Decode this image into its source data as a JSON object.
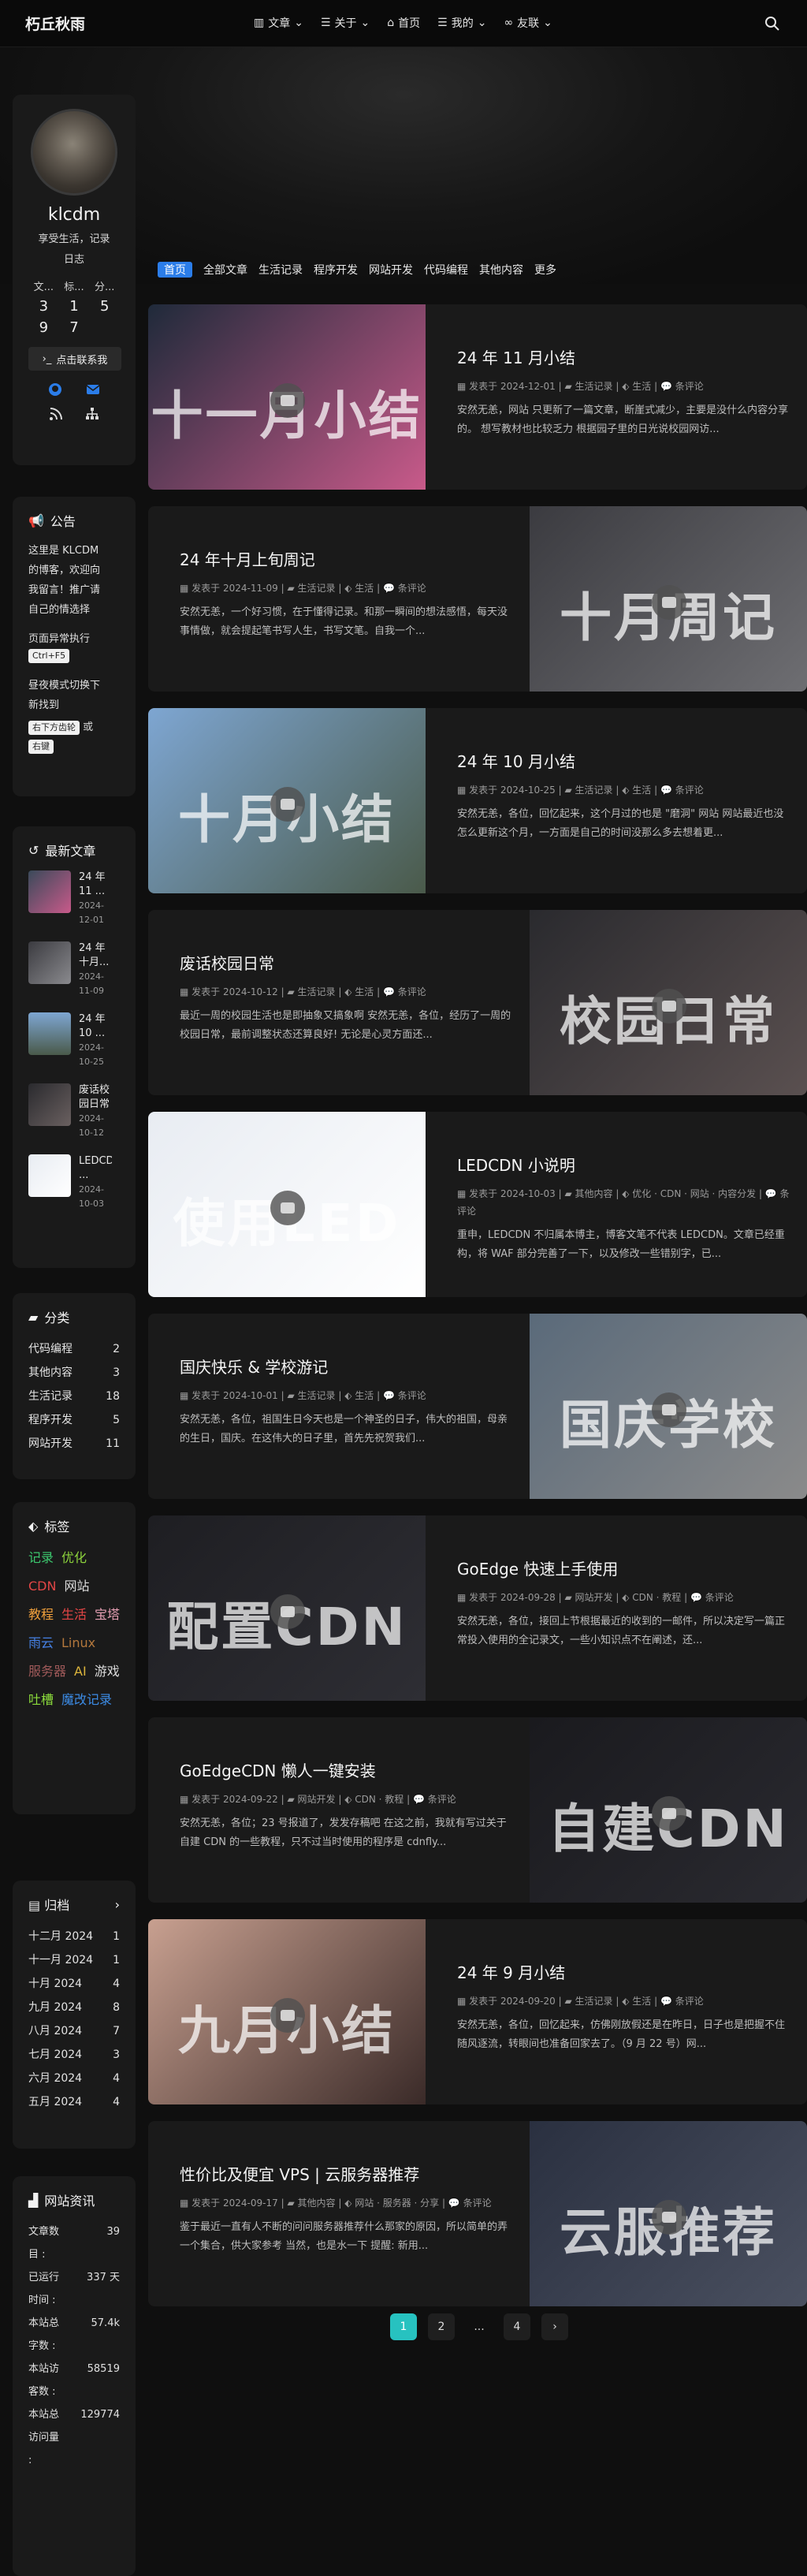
{
  "nav": {
    "logo": "朽丘秋雨",
    "items": [
      {
        "label": "文章",
        "icon": "books-icon"
      },
      {
        "label": "关于",
        "icon": "list-icon"
      },
      {
        "label": "首页",
        "icon": "home-icon"
      },
      {
        "label": "我的",
        "icon": "list-icon"
      },
      {
        "label": "友联",
        "icon": "link-icon"
      }
    ]
  },
  "author": {
    "name": "klcdm",
    "desc_lines": [
      "享受生活，记录",
      "日志"
    ],
    "stats": [
      {
        "label": "文...",
        "value": "3"
      },
      {
        "label": "标...",
        "value": "1"
      },
      {
        "label": "分...",
        "value": "5"
      },
      {
        "label": "",
        "value": "9"
      },
      {
        "label": "",
        "value": "7"
      },
      {
        "label": "",
        "value": ""
      }
    ],
    "contact_label": "点击联系我"
  },
  "announcement": {
    "title": "公告",
    "text": "这里是 KLCDM 的博客，欢迎向我留言！推广请自己的情选择",
    "error_label": "页面异常执行",
    "error_kbd": "Ctrl+F5",
    "dark_text": "昼夜模式切换下 新找到",
    "kbd1": "右下方齿轮",
    "or": "或",
    "kbd2": "右键"
  },
  "recent": {
    "title": "最新文章",
    "items": [
      {
        "title": "24 年 11 ...",
        "date": "2024-12-01"
      },
      {
        "title": "24 年十月...",
        "date": "2024-11-09"
      },
      {
        "title": "24 年 10 ...",
        "date": "2024-10-25"
      },
      {
        "title": "废话校园日常",
        "date": "2024-10-12"
      },
      {
        "title": "LEDCDN ...",
        "date": "2024-10-03"
      }
    ]
  },
  "categories": {
    "title": "分类",
    "items": [
      {
        "name": "代码编程",
        "count": "2"
      },
      {
        "name": "其他内容",
        "count": "3"
      },
      {
        "name": "生活记录",
        "count": "18"
      },
      {
        "name": "程序开发",
        "count": "5"
      },
      {
        "name": "网站开发",
        "count": "11"
      }
    ]
  },
  "tags": {
    "title": "标签",
    "items": [
      {
        "name": "记录",
        "color": "#3cc86e"
      },
      {
        "name": "优化",
        "color": "#8cd23c"
      },
      {
        "name": "CDN",
        "color": "#e14646"
      },
      {
        "name": "网站",
        "color": "#dcdcdc"
      },
      {
        "name": "教程",
        "color": "#f0a03c"
      },
      {
        "name": "生活",
        "color": "#e64646"
      },
      {
        "name": "宝塔",
        "color": "#e6a0b4"
      },
      {
        "name": "雨云",
        "color": "#4682e6"
      },
      {
        "name": "Linux",
        "color": "#b4783c"
      },
      {
        "name": "服务器",
        "color": "#a05a5a"
      },
      {
        "name": "AI",
        "color": "#dcb43c"
      },
      {
        "name": "游戏",
        "color": "#dcdcdc"
      },
      {
        "name": "吐槽",
        "color": "#8cdc3c"
      },
      {
        "name": "魔改记录",
        "color": "#3c8ce6"
      }
    ]
  },
  "archive": {
    "title": "归档",
    "items": [
      {
        "name": "十二月 2024",
        "count": "1"
      },
      {
        "name": "十一月 2024",
        "count": "1"
      },
      {
        "name": "十月 2024",
        "count": "4"
      },
      {
        "name": "九月 2024",
        "count": "8"
      },
      {
        "name": "八月 2024",
        "count": "7"
      },
      {
        "name": "七月 2024",
        "count": "3"
      },
      {
        "name": "六月 2024",
        "count": "4"
      },
      {
        "name": "五月 2024",
        "count": "4"
      }
    ]
  },
  "siteinfo": {
    "title": "网站资讯",
    "items": [
      {
        "label": "文章数目 :",
        "value": "39"
      },
      {
        "label": "已运行时间 :",
        "value": "337 天"
      },
      {
        "label": "本站总字数 :",
        "value": "57.4k"
      },
      {
        "label": "本站访客数 :",
        "value": "58519"
      },
      {
        "label": "本站总访问量 :",
        "value": "129774"
      }
    ]
  },
  "catbar": [
    "首页",
    "全部文章",
    "生活记录",
    "程序开发",
    "网站开发",
    "代码编程",
    "其他内容",
    "更多"
  ],
  "posts": [
    {
      "title": "24 年 11 月小结",
      "date": "2024-12-01",
      "cat": "生活记录",
      "tags": "生活",
      "comment": "条评论",
      "excerpt": "安然无恙，网站 只更新了一篇文章，断崖式减少，主要是没什么内容分享的。 想写教材也比较乏力 根据园子里的日光说校园网访...",
      "img_label": "十一月小结",
      "img_colors": [
        "#1f2a3a",
        "#c85a8a"
      ]
    },
    {
      "title": "24 年十月上旬周记",
      "date": "2024-11-09",
      "cat": "生活记录",
      "tags": "生活",
      "comment": "条评论",
      "excerpt": "安然无恙，一个好习惯，在于懂得记录。和那一瞬间的想法感悟，每天没事情做，就会提起笔书写人生，书写文笔。自我一个...",
      "img_label": "十月周记",
      "img_colors": [
        "#3b3b40",
        "#6e6e72"
      ]
    },
    {
      "title": "24 年 10 月小结",
      "date": "2024-10-25",
      "cat": "生活记录",
      "tags": "生活",
      "comment": "条评论",
      "excerpt": "安然无恙，各位，回忆起来，这个月过的也是 \"磨洞\" 网站 网站最近也没怎么更新这个月，一方面是自己的时间没那么多去想着更...",
      "img_label": "十月小结",
      "img_colors": [
        "#7ea6d2",
        "#4a5a4a"
      ]
    },
    {
      "title": "废话校园日常",
      "date": "2024-10-12",
      "cat": "生活记录",
      "tags": "生活",
      "comment": "条评论",
      "excerpt": "最近一周的校园生活也是即抽象又搞象啊 安然无恙，各位，经历了一周的校园日常，最前调整状态还算良好! 无论是心灵方面还...",
      "img_label": "校园日常",
      "img_colors": [
        "#2a2a2e",
        "#5a5050"
      ]
    },
    {
      "title": "LEDCDN 小说明",
      "date": "2024-10-03",
      "cat": "其他内容",
      "tags": "优化 · CDN · 网站 · 内容分发",
      "comment": "条评论",
      "excerpt": "重申，LEDCDN 不归属本博主，博客文笔不代表 LEDCDN。文章已经重构，将 WAF 部分完善了一下，以及修改一些错别字，已...",
      "img_label": "使用LED",
      "img_colors": [
        "#e8ecf2",
        "#ffffff"
      ]
    },
    {
      "title": "国庆快乐 & 学校游记",
      "date": "2024-10-01",
      "cat": "生活记录",
      "tags": "生活",
      "comment": "条评论",
      "excerpt": "安然无恙，各位，祖国生日今天也是一个神圣的日子，伟大的祖国，母亲的生日，国庆。在这伟大的日子里，首先先祝贺我们...",
      "img_label": "国庆学校",
      "img_colors": [
        "#5a6a7a",
        "#8a8a8a"
      ]
    },
    {
      "title": "GoEdge 快速上手使用",
      "date": "2024-09-28",
      "cat": "网站开发",
      "tags": "CDN · 教程",
      "comment": "条评论",
      "excerpt": "安然无恙，各位，接回上节根据最近的收到的一邮件，所以决定写一篇正常投入使用的全记录文，一些小知识点不在阐述，还...",
      "img_label": "配置CDN",
      "img_colors": [
        "#1e1e22",
        "#2e2e34"
      ]
    },
    {
      "title": "GoEdgeCDN 懒人一键安装",
      "date": "2024-09-22",
      "cat": "网站开发",
      "tags": "CDN · 教程",
      "comment": "条评论",
      "excerpt": "安然无恙，各位；23 号报道了，发发存稿吧 在这之前，我就有写过关于自建 CDN 的一些教程，只不过当时使用的程序是 cdnfly...",
      "img_label": "自建CDN",
      "img_colors": [
        "#1a1a1e",
        "#2a2a30"
      ]
    },
    {
      "title": "24 年 9 月小结",
      "date": "2024-09-20",
      "cat": "生活记录",
      "tags": "生活",
      "comment": "条评论",
      "excerpt": "安然无恙，各位，回忆起来，仿佛刚放假还是在昨日，日子也是把握不住随风逐流，转眼间也准备回家去了。（9 月 22 号）网...",
      "img_label": "九月小结",
      "img_colors": [
        "#c8a090",
        "#3a2a28"
      ]
    },
    {
      "title": "性价比及便宜 VPS | 云服务器推荐",
      "date": "2024-09-17",
      "cat": "其他内容",
      "tags": "网站 · 服务器 · 分享",
      "comment": "条评论",
      "excerpt": "鉴于最近一直有人不断的问问服务器推荐什么那家的原因，所以简单的弄一个集合，供大家参考 当然，也是水一下 提醒: 新用...",
      "img_label": "云服推荐",
      "img_colors": [
        "#2a3040",
        "#4a5060"
      ]
    }
  ],
  "meta_labels": {
    "published": "发表于"
  },
  "pagination": [
    "1",
    "2",
    "...",
    "4",
    "›"
  ]
}
